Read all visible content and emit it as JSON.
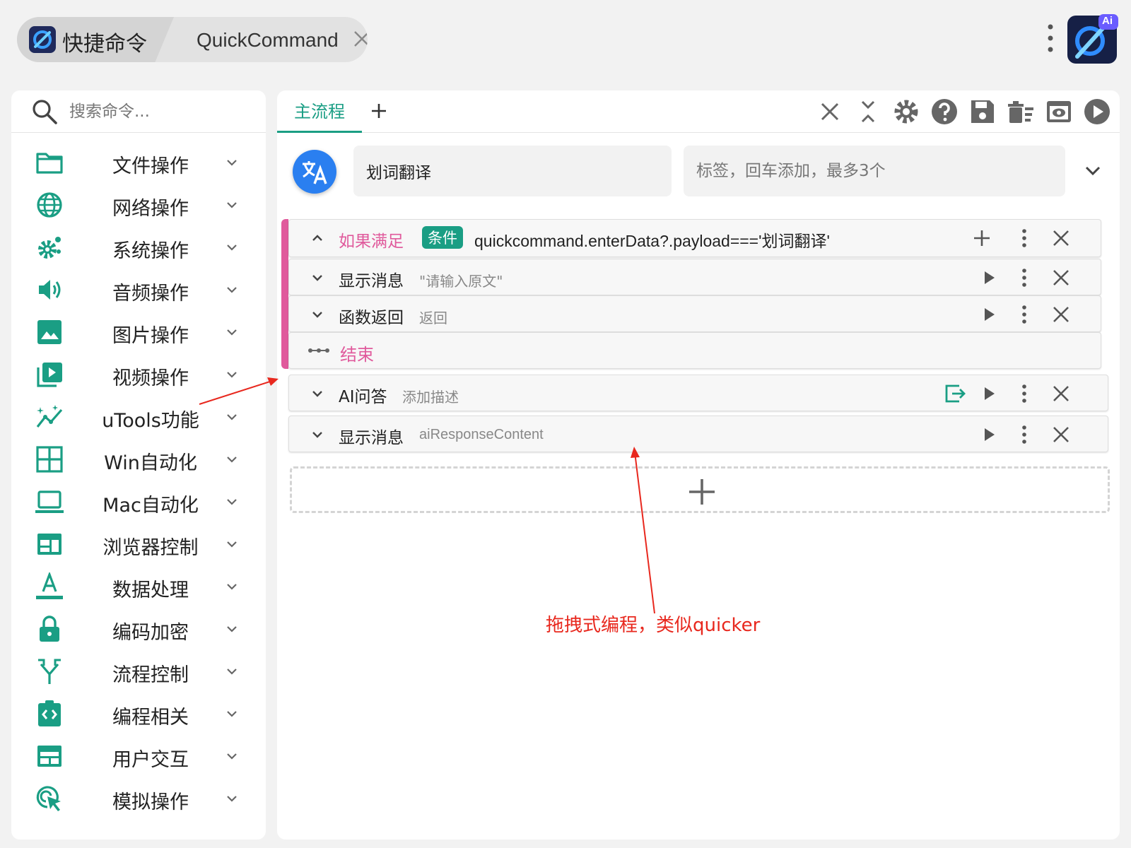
{
  "window": {
    "app_title": "快捷命令",
    "tab_name": "QuickCommand",
    "logo_badge": "Ai"
  },
  "search": {
    "placeholder": "搜索命令..."
  },
  "sidebar": {
    "items": [
      {
        "label": "文件操作",
        "icon": "folder-icon"
      },
      {
        "label": "网络操作",
        "icon": "globe-icon"
      },
      {
        "label": "系统操作",
        "icon": "gears-icon"
      },
      {
        "label": "音频操作",
        "icon": "speaker-icon"
      },
      {
        "label": "图片操作",
        "icon": "image-icon"
      },
      {
        "label": "视频操作",
        "icon": "video-library-icon"
      },
      {
        "label": "uTools功能",
        "icon": "auto-graph-icon"
      },
      {
        "label": "Win自动化",
        "icon": "window-grid-icon"
      },
      {
        "label": "Mac自动化",
        "icon": "laptop-icon"
      },
      {
        "label": "浏览器控制",
        "icon": "browser-icon"
      },
      {
        "label": "数据处理",
        "icon": "text-format-icon"
      },
      {
        "label": "编码加密",
        "icon": "lock-icon"
      },
      {
        "label": "流程控制",
        "icon": "fork-icon"
      },
      {
        "label": "编程相关",
        "icon": "code-clipboard-icon"
      },
      {
        "label": "用户交互",
        "icon": "web-layout-icon"
      },
      {
        "label": "模拟操作",
        "icon": "ads-click-icon"
      }
    ]
  },
  "editor": {
    "tab_main": "主流程",
    "command_name": "划词翻译",
    "tags_placeholder": "标签，回车添加，最多3个",
    "condition": {
      "label": "如果满足",
      "badge": "条件",
      "expression": "quickcommand.enterData?.payload==='划词翻译'"
    },
    "steps": [
      {
        "title": "显示消息",
        "desc": "\"请输入原文\""
      },
      {
        "title": "函数返回",
        "desc": "返回"
      }
    ],
    "end_label": "结束",
    "outer_steps": [
      {
        "title": "AI问答",
        "desc": "添加描述"
      },
      {
        "title": "显示消息",
        "desc": "aiResponseContent"
      }
    ]
  },
  "annotation": {
    "text": "拖拽式编程，类似quicker",
    "color": "#e8281e"
  },
  "colors": {
    "accent": "#1a9e84",
    "condition": "#e05a9c",
    "avatar": "#2a7ff0"
  }
}
